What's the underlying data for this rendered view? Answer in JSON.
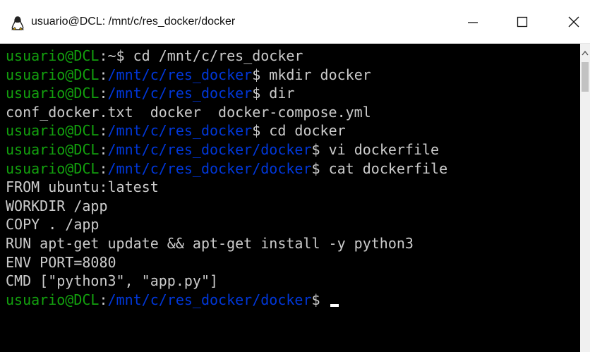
{
  "window": {
    "title": "usuario@DCL: /mnt/c/res_docker/docker",
    "icon": "linux-tux-icon",
    "controls": {
      "minimize": "minimize-icon",
      "maximize": "maximize-icon",
      "close": "close-icon"
    }
  },
  "terminal": {
    "colors": {
      "background": "#000000",
      "user": "#13a10e",
      "path": "#0037da",
      "text": "#cccccc"
    },
    "lines": [
      {
        "user": "usuario@DCL",
        "path": "~",
        "cmd": "$ cd /mnt/c/res_docker"
      },
      {
        "user": "usuario@DCL",
        "path": "/mnt/c/res_docker",
        "cmd": "$ mkdir docker"
      },
      {
        "user": "usuario@DCL",
        "path": "/mnt/c/res_docker",
        "cmd": "$ dir"
      },
      {
        "text": "conf_docker.txt  docker  docker-compose.yml"
      },
      {
        "user": "usuario@DCL",
        "path": "/mnt/c/res_docker",
        "cmd": "$ cd docker"
      },
      {
        "user": "usuario@DCL",
        "path": "/mnt/c/res_docker/docker",
        "cmd": "$ vi dockerfile"
      },
      {
        "user": "usuario@DCL",
        "path": "/mnt/c/res_docker/docker",
        "cmd": "$ cat dockerfile"
      },
      {
        "text": "FROM ubuntu:latest"
      },
      {
        "text": "WORKDIR /app"
      },
      {
        "text": "COPY . /app"
      },
      {
        "text": "RUN apt-get update && apt-get install -y python3"
      },
      {
        "text": "ENV PORT=8080"
      },
      {
        "text": "CMD [\"python3\", \"app.py\"]"
      },
      {
        "user": "usuario@DCL",
        "path": "/mnt/c/res_docker/docker",
        "cmd": "$ "
      }
    ]
  }
}
